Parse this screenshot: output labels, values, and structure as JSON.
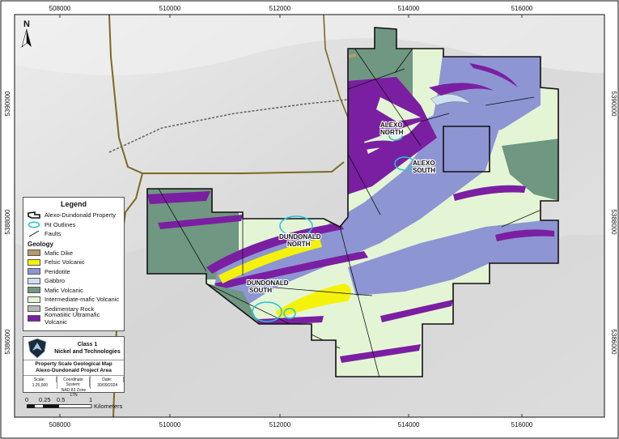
{
  "map": {
    "x_ticks": [
      "508000",
      "510000",
      "512000",
      "514000",
      "516000"
    ],
    "y_ticks": [
      "5390000",
      "5388000",
      "5386000"
    ],
    "north_arrow": "N",
    "place_labels": [
      {
        "line1": "ALEXO",
        "line2": "NORTH"
      },
      {
        "line1": "ALEXO",
        "line2": "SOUTH"
      },
      {
        "line1": "DUNDONALD",
        "line2": "NORTH"
      },
      {
        "line1": "DUNDONALD",
        "line2": "SOUTH"
      }
    ]
  },
  "legend": {
    "title": "Legend",
    "items": [
      {
        "label": "Alexo-Dundonald Property",
        "icon": "property-outline-icon"
      },
      {
        "label": "Pit Outlines",
        "icon": "pit-outline-icon",
        "color": "#27c4d6"
      },
      {
        "label": "Faults",
        "icon": "fault-line-icon"
      }
    ],
    "geology_title": "Geology",
    "geology": [
      {
        "label": "Mafic Dike",
        "color": "#b59b6a"
      },
      {
        "label": "Felsic Volcanic",
        "color": "#f4f20a"
      },
      {
        "label": "Peridotite",
        "color": "#8d95d3"
      },
      {
        "label": "Gabbro",
        "color": "#cfe0ee"
      },
      {
        "label": "Mafic Volcanic",
        "color": "#6f9781"
      },
      {
        "label": "Intermediate-mafic Volcanic",
        "color": "#e4f5d6"
      },
      {
        "label": "Sedimentary Rock",
        "color": "#b7b7b7"
      },
      {
        "label": "Komatiitic Ultramafic Volcanic",
        "color": "#7b1fa2"
      }
    ]
  },
  "title_block": {
    "company_line1": "Class 1",
    "company_line2": "Nickel and Technologies",
    "map_title_line1": "Property Scale Geological Map",
    "map_title_line2": "Alexo-Dundonald Project Area",
    "scale_label": "Scale:",
    "scale_value": "1:25,000",
    "crs_label": "Coordinate System:",
    "crs_value": "NAD 83 Zone 17N",
    "date_label": "Date:",
    "date_value": "30/09/2024"
  },
  "scale_bar": {
    "ticks": [
      "0",
      "0.25",
      "0.5",
      "1"
    ],
    "unit": "Kilometers"
  }
}
